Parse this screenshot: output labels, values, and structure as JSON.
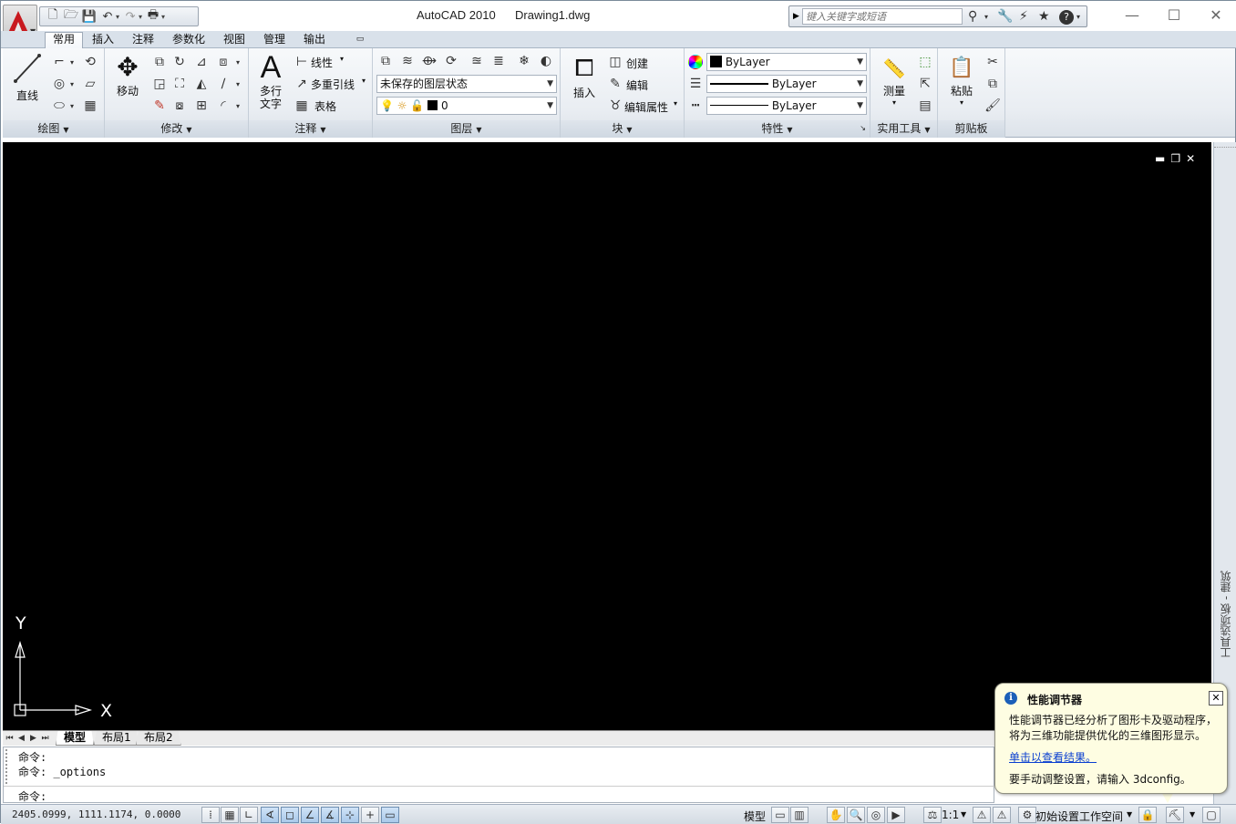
{
  "window": {
    "app_title": "AutoCAD 2010",
    "document_title": "Drawing1.dwg",
    "controls": {
      "minimize": "—",
      "maximize": "☐",
      "close": "✕"
    }
  },
  "quick_access": {
    "icons": [
      "new-icon",
      "open-icon",
      "save-icon",
      "undo-icon",
      "redo-icon",
      "plot-icon"
    ]
  },
  "search": {
    "placeholder": "键入关键字或短语"
  },
  "ribbon_tabs": [
    {
      "label": "常用",
      "active": true
    },
    {
      "label": "插入"
    },
    {
      "label": "注释"
    },
    {
      "label": "参数化"
    },
    {
      "label": "视图"
    },
    {
      "label": "管理"
    },
    {
      "label": "输出"
    }
  ],
  "panels": {
    "draw": {
      "title": "绘图",
      "line_label": "直线"
    },
    "modify": {
      "title": "修改",
      "move_label": "移动"
    },
    "annotation": {
      "title": "注释",
      "mtext_label1": "多行",
      "mtext_label2": "文字",
      "linear_label": "线性",
      "mleader_label": "多重引线",
      "table_label": "表格"
    },
    "layers": {
      "title": "图层",
      "state_value": "未保存的图层状态",
      "layer_value": "0"
    },
    "block": {
      "title": "块",
      "insert_label": "插入",
      "create_label": "创建",
      "edit_label": "编辑",
      "edit_attr_label": "编辑属性"
    },
    "properties": {
      "title": "特性",
      "color_value": "ByLayer",
      "linetype_value": "ByLayer",
      "lineweight_value": "ByLayer"
    },
    "utilities": {
      "title": "实用工具",
      "measure_label": "测量"
    },
    "clipboard": {
      "title": "剪贴板",
      "paste_label": "粘贴"
    }
  },
  "side_palette": {
    "label": "工具选项板 - 建筑"
  },
  "ucs": {
    "y_label": "Y",
    "x_label": "X"
  },
  "layout_tabs": [
    {
      "label": "模型",
      "active": true
    },
    {
      "label": "布局1"
    },
    {
      "label": "布局2"
    }
  ],
  "command": {
    "line1": "命令:",
    "line2": "命令: _options",
    "prompt": "命令:"
  },
  "status": {
    "coordinates": "2405.0999, 1111.1174, 0.0000",
    "model_label": "模型",
    "scale_label": "1:1",
    "workspace_label": "初始设置工作空间"
  },
  "balloon": {
    "title": "性能调节器",
    "body": "性能调节器已经分析了图形卡及驱动程序，将为三维功能提供优化的三维图形显示。",
    "link": "单击以查看结果。",
    "footer": "要手动调整设置，请输入 3dconfig。"
  },
  "colors": {
    "canvas": "#000000",
    "accent": "#c8191e",
    "link": "#0a3fd0",
    "balloon_bg": "#fefde2"
  }
}
